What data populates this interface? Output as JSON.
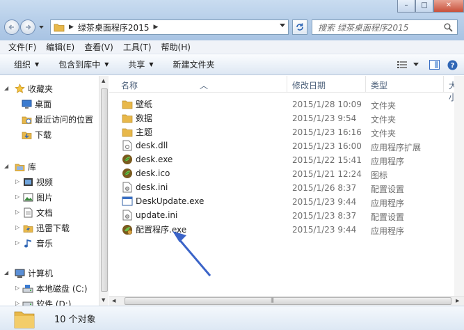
{
  "window": {
    "minimize": "–",
    "maximize": "□",
    "close": "✕"
  },
  "address": {
    "breadcrumb": "绿茶桌面程序2015"
  },
  "search": {
    "placeholder": "搜索 绿茶桌面程序2015"
  },
  "menu": [
    "文件(F)",
    "编辑(E)",
    "查看(V)",
    "工具(T)",
    "帮助(H)"
  ],
  "commands": {
    "organize": "组织",
    "include_library": "包含到库中",
    "share": "共享",
    "new_folder": "新建文件夹"
  },
  "nav": {
    "favorites": "收藏夹",
    "desktop": "桌面",
    "recent": "最近访问的位置",
    "downloads": "下载",
    "libraries": "库",
    "videos": "视频",
    "pictures": "图片",
    "documents": "文档",
    "thunder": "迅雷下载",
    "music": "音乐",
    "computer": "计算机",
    "drive_c": "本地磁盘 (C:)",
    "drive_d": "软件 (D:)"
  },
  "columns": {
    "name": "名称",
    "modified": "修改日期",
    "type": "类型",
    "size": "大小"
  },
  "files": [
    {
      "name": "壁纸",
      "date": "2015/1/28 10:09",
      "type": "文件夹",
      "icon": "folder-icon"
    },
    {
      "name": "数据",
      "date": "2015/1/23 9:54",
      "type": "文件夹",
      "icon": "folder-icon"
    },
    {
      "name": "主题",
      "date": "2015/1/23 16:16",
      "type": "文件夹",
      "icon": "folder-icon"
    },
    {
      "name": "desk.dll",
      "date": "2015/1/23 16:00",
      "type": "应用程序扩展",
      "icon": "dll-icon"
    },
    {
      "name": "desk.exe",
      "date": "2015/1/22 15:41",
      "type": "应用程序",
      "icon": "green-leaf-icon"
    },
    {
      "name": "desk.ico",
      "date": "2015/1/21 12:24",
      "type": "图标",
      "icon": "green-leaf-icon"
    },
    {
      "name": "desk.ini",
      "date": "2015/1/26 8:37",
      "type": "配置设置",
      "icon": "ini-icon"
    },
    {
      "name": "DeskUpdate.exe",
      "date": "2015/1/23 9:44",
      "type": "应用程序",
      "icon": "window-exe-icon"
    },
    {
      "name": "update.ini",
      "date": "2015/1/23 8:37",
      "type": "配置设置",
      "icon": "ini-icon"
    },
    {
      "name": "配置程序.exe",
      "date": "2015/1/23 9:44",
      "type": "应用程序",
      "icon": "config-exe-icon"
    }
  ],
  "status": {
    "count": "10 个对象"
  },
  "colors": {
    "accent": "#3a6fc4",
    "folder": "#e8b84a",
    "arrow": "#3b64c8"
  }
}
